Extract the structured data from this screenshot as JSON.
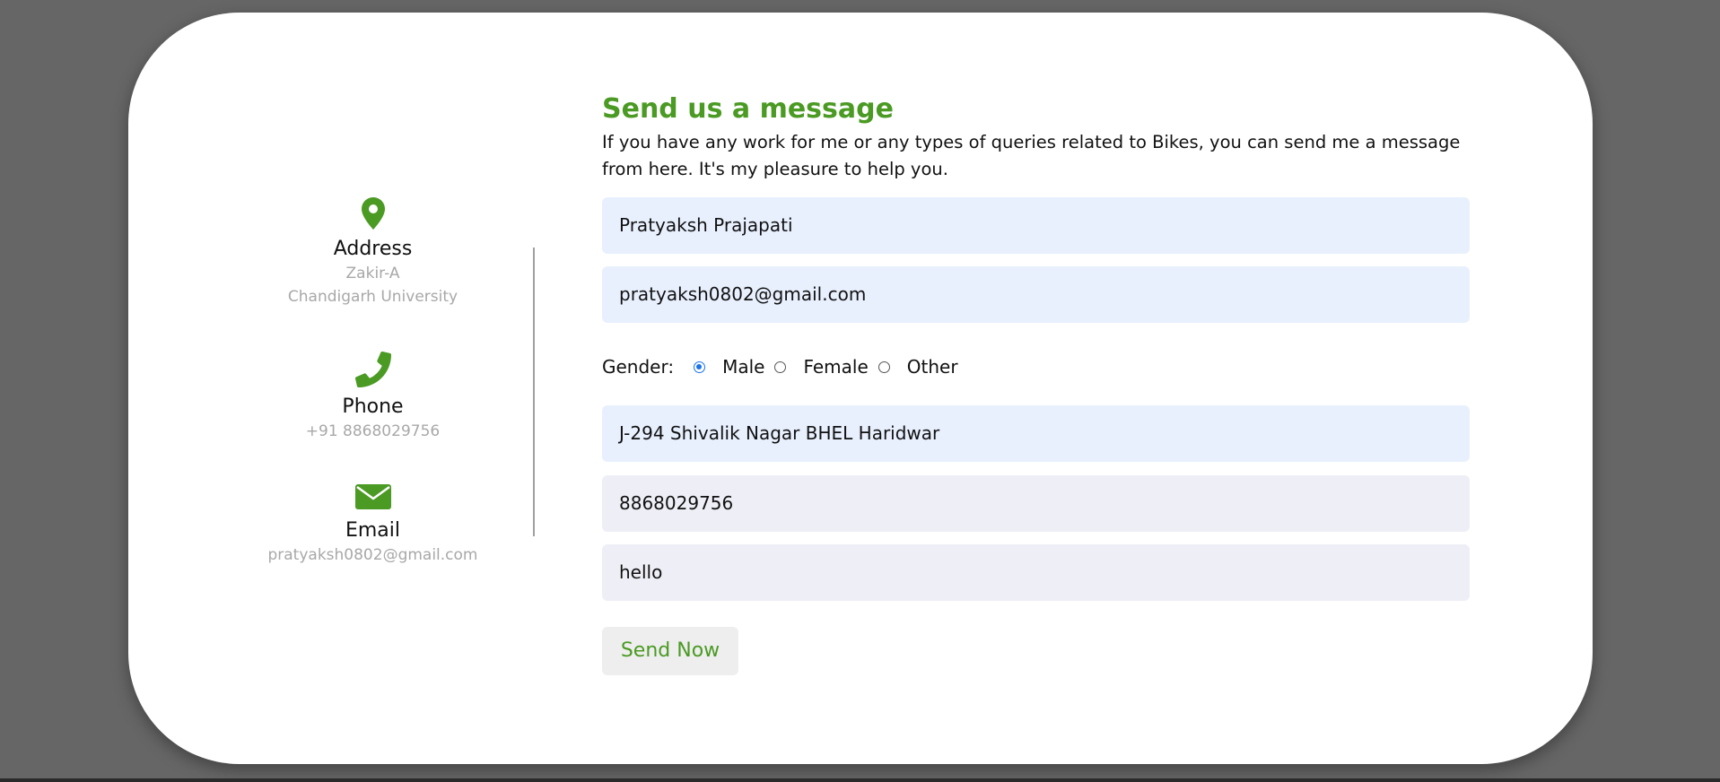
{
  "contact_info": {
    "address": {
      "icon": "map-pin-icon",
      "title": "Address",
      "line1": "Zakir-A",
      "line2": "Chandigarh University"
    },
    "phone": {
      "icon": "phone-icon",
      "title": "Phone",
      "value": "+91 8868029756"
    },
    "email": {
      "icon": "envelope-icon",
      "title": "Email",
      "value": "pratyaksh0802@gmail.com"
    }
  },
  "form": {
    "title": "Send us a message",
    "description": "If you have any work for me or any types of queries related to Bikes, you can send me a message from here. It's my pleasure to help you.",
    "name_value": "Pratyaksh Prajapati",
    "email_value": "pratyaksh0802@gmail.com",
    "gender": {
      "label": "Gender:",
      "options": [
        "Male",
        "Female",
        "Other"
      ],
      "selected": "Male"
    },
    "address_value": "J-294 Shivalik Nagar BHEL Haridwar",
    "phone_value": "8868029756",
    "message_value": "hello",
    "submit_label": "Send Now"
  },
  "colors": {
    "accent": "#4a9a23",
    "page_background": "#666666",
    "card_background": "#ffffff",
    "autofill_field": "#e8f0fe",
    "plain_field": "#eeeff6",
    "muted_text": "#a8a8a8"
  }
}
